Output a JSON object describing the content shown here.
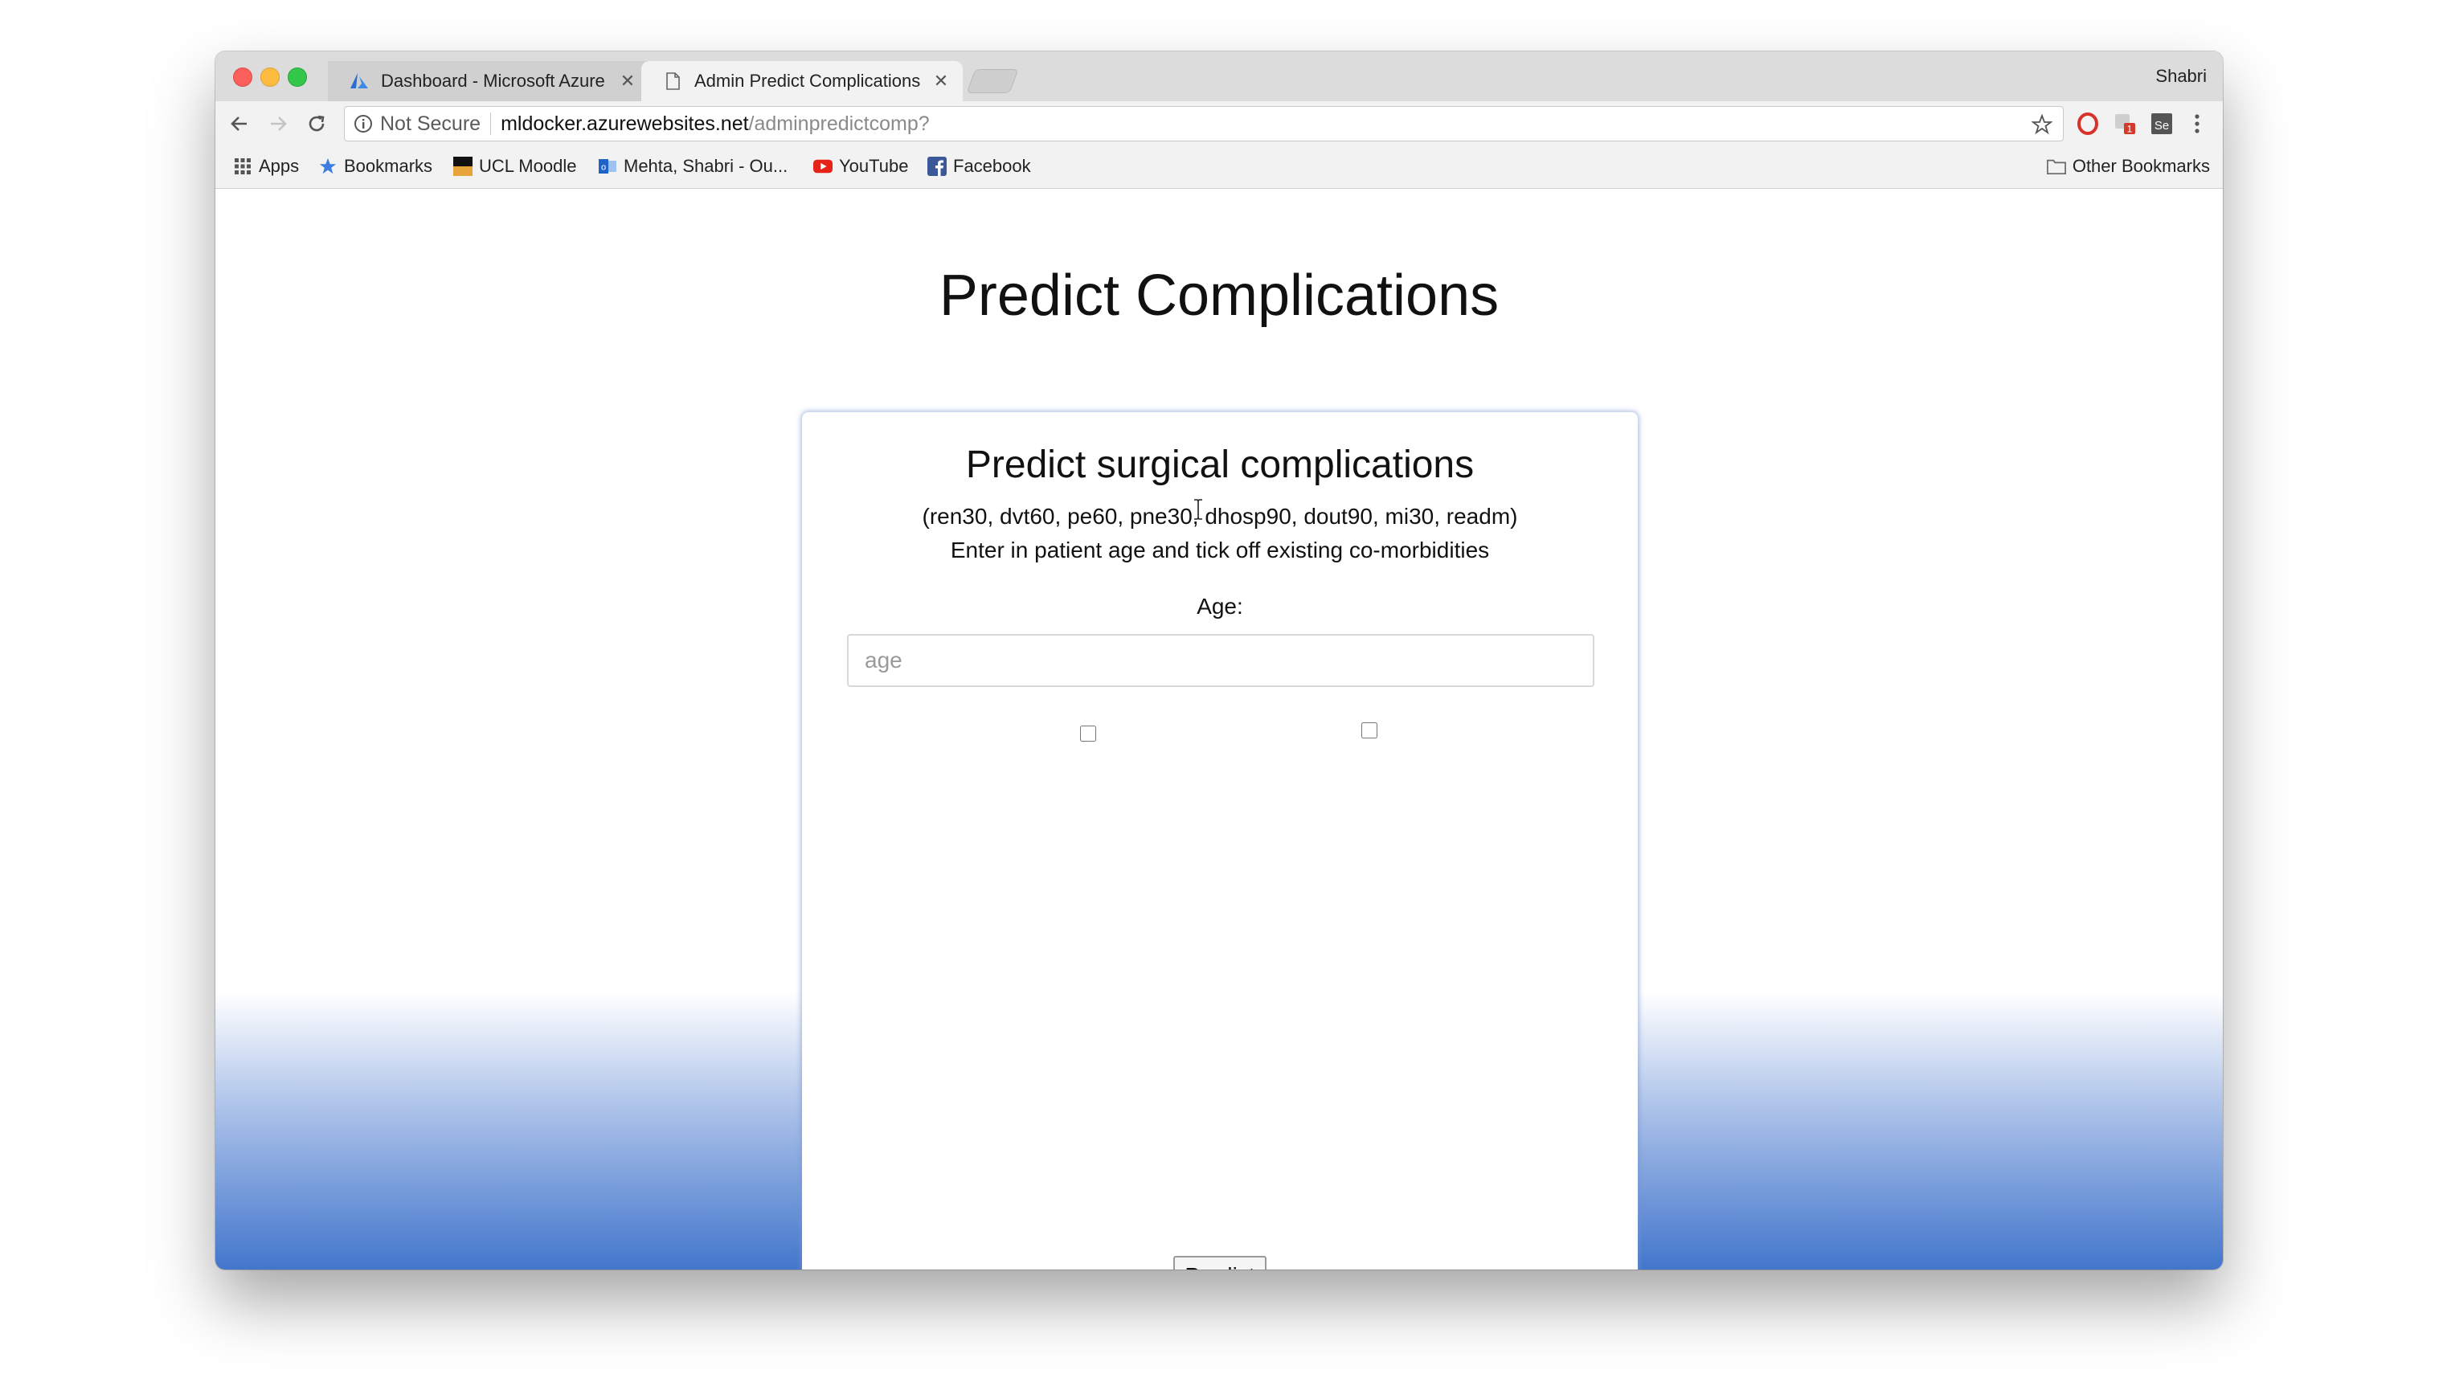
{
  "browser": {
    "profile_name": "Shabri",
    "tabs": [
      {
        "title": "Dashboard - Microsoft Azure",
        "active": false,
        "icon": "azure-icon"
      },
      {
        "title": "Admin Predict Complications",
        "active": true,
        "icon": "page-icon"
      }
    ],
    "address_bar": {
      "security_label": "Not Secure",
      "url_host": "mldocker.azurewebsites.net",
      "url_path": "/adminpredictcomp?"
    },
    "bookmarks": [
      {
        "label": "Apps",
        "icon": "apps-grid-icon"
      },
      {
        "label": "Bookmarks",
        "icon": "star-icon"
      },
      {
        "label": "UCL Moodle",
        "icon": "ucl-icon"
      },
      {
        "label": "Mehta, Shabri - Ou...",
        "icon": "outlook-icon"
      },
      {
        "label": "YouTube",
        "icon": "youtube-icon"
      },
      {
        "label": "Facebook",
        "icon": "facebook-icon"
      }
    ],
    "other_bookmarks": "Other Bookmarks",
    "extension_badge": "1"
  },
  "page": {
    "title": "Predict Complications",
    "card": {
      "title": "Predict surgical complications",
      "subtitle": "(ren30, dvt60, pe60, pne30, dhosp90, dout90, mi30, readm)",
      "instruction": "Enter in patient age and tick off existing co-morbidities",
      "age_label": "Age:",
      "age_placeholder": "age",
      "age_value": "",
      "checkboxes": [
        false,
        false
      ],
      "predict_label": "Predict"
    }
  },
  "colors": {
    "gradient_bottom": "#4276cc",
    "card_glow": "#7896d2"
  }
}
